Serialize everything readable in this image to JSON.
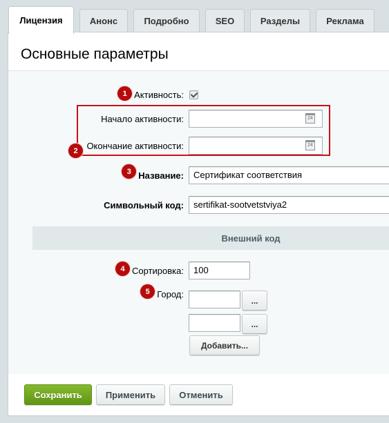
{
  "tabs": [
    {
      "label": "Лицензия",
      "active": true
    },
    {
      "label": "Анонс",
      "active": false
    },
    {
      "label": "Подробно",
      "active": false
    },
    {
      "label": "SEO",
      "active": false
    },
    {
      "label": "Разделы",
      "active": false
    },
    {
      "label": "Реклама",
      "active": false
    }
  ],
  "page": {
    "title": "Основные параметры"
  },
  "fields": {
    "active": {
      "label": "Активность:",
      "checked": true,
      "badge": "1"
    },
    "active_from": {
      "label": "Начало активности:",
      "value": ""
    },
    "active_to": {
      "label": "Окончание активности:",
      "value": "",
      "badge": "2"
    },
    "name": {
      "label": "Название:",
      "value": "Сертификат соответствия",
      "badge": "3"
    },
    "code": {
      "label": "Символьный код:",
      "value": "sertifikat-sootvetstviya2"
    },
    "external_code": {
      "label": "Внешний код"
    },
    "sort": {
      "label": "Сортировка:",
      "value": "100",
      "badge": "4"
    },
    "city": {
      "label": "Город:",
      "badge": "5",
      "values": [
        "",
        ""
      ],
      "browse_label": "...",
      "add_label": "Добавить..."
    }
  },
  "calendar_icon_text": "24",
  "buttons": {
    "save": "Сохранить",
    "apply": "Применить",
    "cancel": "Отменить"
  },
  "colors": {
    "highlight": "#c8101a",
    "badge": "#b70b0b",
    "save": "#6fa51f"
  }
}
